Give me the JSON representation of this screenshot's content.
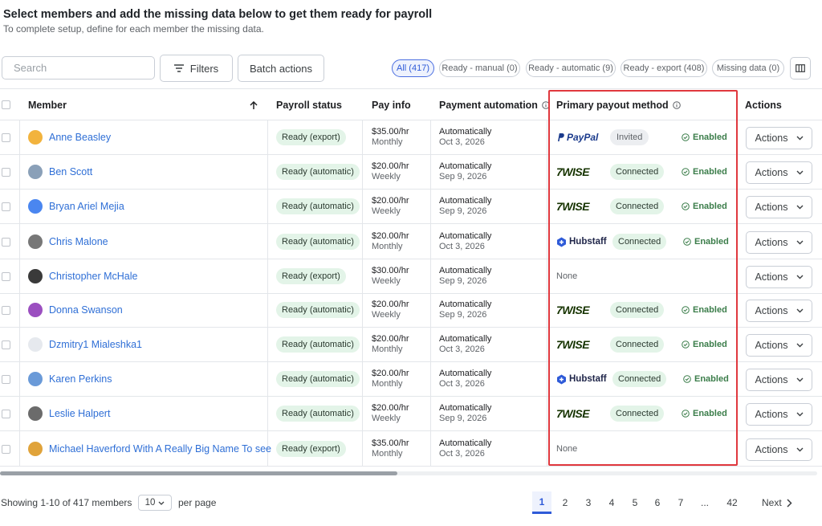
{
  "header": {
    "title": "Select members and add the missing data below to get them ready for payroll",
    "subtitle": "To complete setup, define for each member the missing data."
  },
  "toolbar": {
    "search_placeholder": "Search",
    "filters_label": "Filters",
    "batch_label": "Batch actions",
    "chips": [
      "All (417)",
      "Ready - manual (0)",
      "Ready - automatic (9)",
      "Ready - export (408)",
      "Missing data (0)"
    ]
  },
  "columns": {
    "member": "Member",
    "payroll_status": "Payroll status",
    "pay_info": "Pay info",
    "payment_automation": "Payment automation",
    "primary_payout": "Primary payout method",
    "actions": "Actions"
  },
  "rows": [
    {
      "name": "Anne Beasley",
      "status": "Ready (export)",
      "rate": "$35.00/hr",
      "period": "Monthly",
      "auto": "Automatically",
      "date": "Oct 3, 2026",
      "payout": "paypal",
      "payout_logo": "PayPal",
      "payout_state": "Invited",
      "enabled": "Enabled",
      "action": "Actions",
      "avatar_color": "#f2b33d"
    },
    {
      "name": "Ben Scott",
      "status": "Ready (automatic)",
      "rate": "$20.00/hr",
      "period": "Weekly",
      "auto": "Automatically",
      "date": "Sep 9, 2026",
      "payout": "wise",
      "payout_logo": "7WISE",
      "payout_state": "Connected",
      "enabled": "Enabled",
      "action": "Actions",
      "avatar_color": "#8aa0b8"
    },
    {
      "name": "Bryan Ariel Mejia",
      "status": "Ready (automatic)",
      "rate": "$20.00/hr",
      "period": "Weekly",
      "auto": "Automatically",
      "date": "Sep 9, 2026",
      "payout": "wise",
      "payout_logo": "7WISE",
      "payout_state": "Connected",
      "enabled": "Enabled",
      "action": "Actions",
      "avatar_color": "#4a86f0"
    },
    {
      "name": "Chris Malone",
      "status": "Ready (automatic)",
      "rate": "$20.00/hr",
      "period": "Monthly",
      "auto": "Automatically",
      "date": "Oct 3, 2026",
      "payout": "hubstaff",
      "payout_logo": "Hubstaff",
      "payout_state": "Connected",
      "enabled": "Enabled",
      "action": "Actions",
      "avatar_color": "#777777"
    },
    {
      "name": "Christopher McHale",
      "status": "Ready (export)",
      "rate": "$30.00/hr",
      "period": "Weekly",
      "auto": "Automatically",
      "date": "Sep 9, 2026",
      "payout": "none",
      "payout_logo": "None",
      "payout_state": "",
      "enabled": "",
      "action": "Actions",
      "avatar_color": "#3a3a3a"
    },
    {
      "name": "Donna Swanson",
      "status": "Ready (automatic)",
      "rate": "$20.00/hr",
      "period": "Weekly",
      "auto": "Automatically",
      "date": "Sep 9, 2026",
      "payout": "wise",
      "payout_logo": "7WISE",
      "payout_state": "Connected",
      "enabled": "Enabled",
      "action": "Actions",
      "avatar_color": "#9b4fc0"
    },
    {
      "name": "Dzmitry1 Mialeshka1",
      "status": "Ready (automatic)",
      "rate": "$20.00/hr",
      "period": "Monthly",
      "auto": "Automatically",
      "date": "Oct 3, 2026",
      "payout": "wise",
      "payout_logo": "7WISE",
      "payout_state": "Connected",
      "enabled": "Enabled",
      "action": "Actions",
      "avatar_color": "#e6e9ee"
    },
    {
      "name": "Karen Perkins",
      "status": "Ready (automatic)",
      "rate": "$20.00/hr",
      "period": "Monthly",
      "auto": "Automatically",
      "date": "Oct 3, 2026",
      "payout": "hubstaff",
      "payout_logo": "Hubstaff",
      "payout_state": "Connected",
      "enabled": "Enabled",
      "action": "Actions",
      "avatar_color": "#6a9ad8"
    },
    {
      "name": "Leslie Halpert",
      "status": "Ready (automatic)",
      "rate": "$20.00/hr",
      "period": "Weekly",
      "auto": "Automatically",
      "date": "Sep 9, 2026",
      "payout": "wise",
      "payout_logo": "7WISE",
      "payout_state": "Connected",
      "enabled": "Enabled",
      "action": "Actions",
      "avatar_color": "#6b6b6b"
    },
    {
      "name": "Michael Haverford With A Really Big Name To see",
      "status": "Ready (export)",
      "rate": "$35.00/hr",
      "period": "Monthly",
      "auto": "Automatically",
      "date": "Oct 3, 2026",
      "payout": "none",
      "payout_logo": "None",
      "payout_state": "",
      "enabled": "",
      "action": "Actions",
      "avatar_color": "#e0a33a"
    }
  ],
  "footer": {
    "showing": "Showing 1-10 of 417 members",
    "per_value": "10",
    "per_label": "per page",
    "pages": [
      "1",
      "2",
      "3",
      "4",
      "5",
      "6",
      "7",
      "...",
      "42"
    ],
    "next": "Next"
  }
}
